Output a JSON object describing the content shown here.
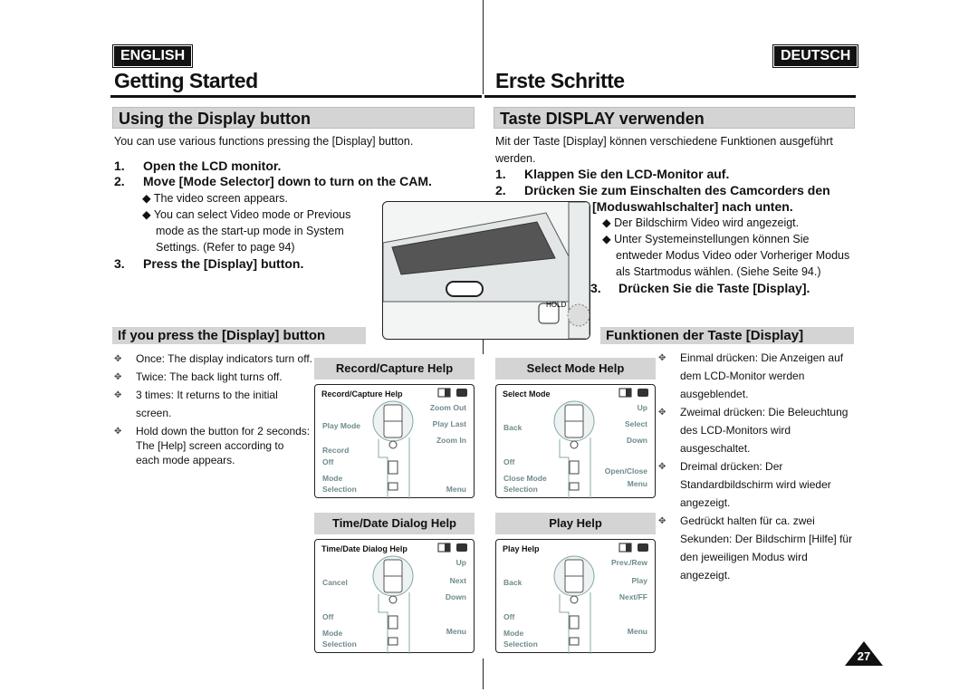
{
  "left": {
    "lang": "ENGLISH",
    "title": "Getting Started",
    "section": "Using the Display button",
    "intro": "You can use various functions pressing the [Display] button.",
    "steps": [
      "1.",
      "Open the LCD monitor.",
      "2.",
      "Move [Mode Selector] down to turn on the CAM.",
      "3.",
      "Press the [Display] button."
    ],
    "bullets": [
      "◆ The video screen appears.",
      "◆ You can select Video mode or Previous",
      "mode as the start-up mode in System",
      "Settings. (Refer to page 94)"
    ],
    "subsection": "If you press the [Display] button",
    "items": [
      "Once: The display indicators turn off.",
      "Twice: The back light turns off.",
      "3 times: It returns to the initial",
      "screen.",
      "Hold down the button for 2 seconds:",
      "The [Help] screen according to",
      "each mode appears."
    ]
  },
  "right": {
    "lang": "DEUTSCH",
    "title": "Erste Schritte",
    "section": "Taste DISPLAY verwenden",
    "intro": [
      "Mit der Taste [Display] können verschiedene Funktionen ausgeführt",
      "werden."
    ],
    "steps": [
      "1.",
      "Klappen Sie den LCD-Monitor auf.",
      "2.",
      "Drücken Sie zum Einschalten des Camcorders den",
      "[Moduswahlschalter] nach unten.",
      "3.",
      "Drücken Sie die Taste [Display]."
    ],
    "bullets": [
      "◆ Der Bildschirm Video wird angezeigt.",
      "◆ Unter Systemeinstellungen können Sie",
      "entweder Modus Video oder Vorheriger Modus",
      "als Startmodus wählen. (Siehe Seite 94.)"
    ],
    "subsection": "Funktionen der Taste [Display]",
    "items": [
      "Einmal drücken: Die Anzeigen auf",
      "dem LCD-Monitor werden",
      "ausgeblendet.",
      "Zweimal drücken: Die Beleuchtung",
      "des LCD-Monitors wird",
      "ausgeschaltet.",
      "Dreimal drücken: Der",
      "Standardbildschirm wird wieder",
      "angezeigt.",
      "Gedrückt halten für ca. zwei",
      "Sekunden: Der Bildschirm [Hilfe] für",
      "den jeweiligen Modus wird",
      "angezeigt."
    ]
  },
  "camera": {
    "hold_label": "HOLD"
  },
  "panels": [
    {
      "header": "Record/Capture Help",
      "title": "Record/Capture Help",
      "left": [
        "Play Mode",
        "Record",
        "Off",
        "Mode",
        "Selection"
      ],
      "right": [
        "Zoom Out",
        "Play Last",
        "Zoom In",
        "Menu"
      ]
    },
    {
      "header": "Select Mode Help",
      "title": "Select Mode",
      "left": [
        "Back",
        "Off",
        "Close Mode",
        "Selection"
      ],
      "right": [
        "Up",
        "Select",
        "Down",
        "Open/Close",
        "Menu"
      ]
    },
    {
      "header": "Time/Date Dialog Help",
      "title": "Time/Date Dialog Help",
      "left": [
        "Cancel",
        "Off",
        "Mode",
        "Selection"
      ],
      "right": [
        "Up",
        "Next",
        "Down",
        "Menu"
      ]
    },
    {
      "header": "Play Help",
      "title": "Play Help",
      "left": [
        "Back",
        "Off",
        "Mode",
        "Selection"
      ],
      "right": [
        "Prev./Rew",
        "Play",
        "Next/FF",
        "Menu"
      ]
    }
  ],
  "page_number": "27",
  "icons": {
    "bullet": "cross-bullet-icon",
    "panel": [
      "display-icon",
      "battery-icon"
    ]
  }
}
